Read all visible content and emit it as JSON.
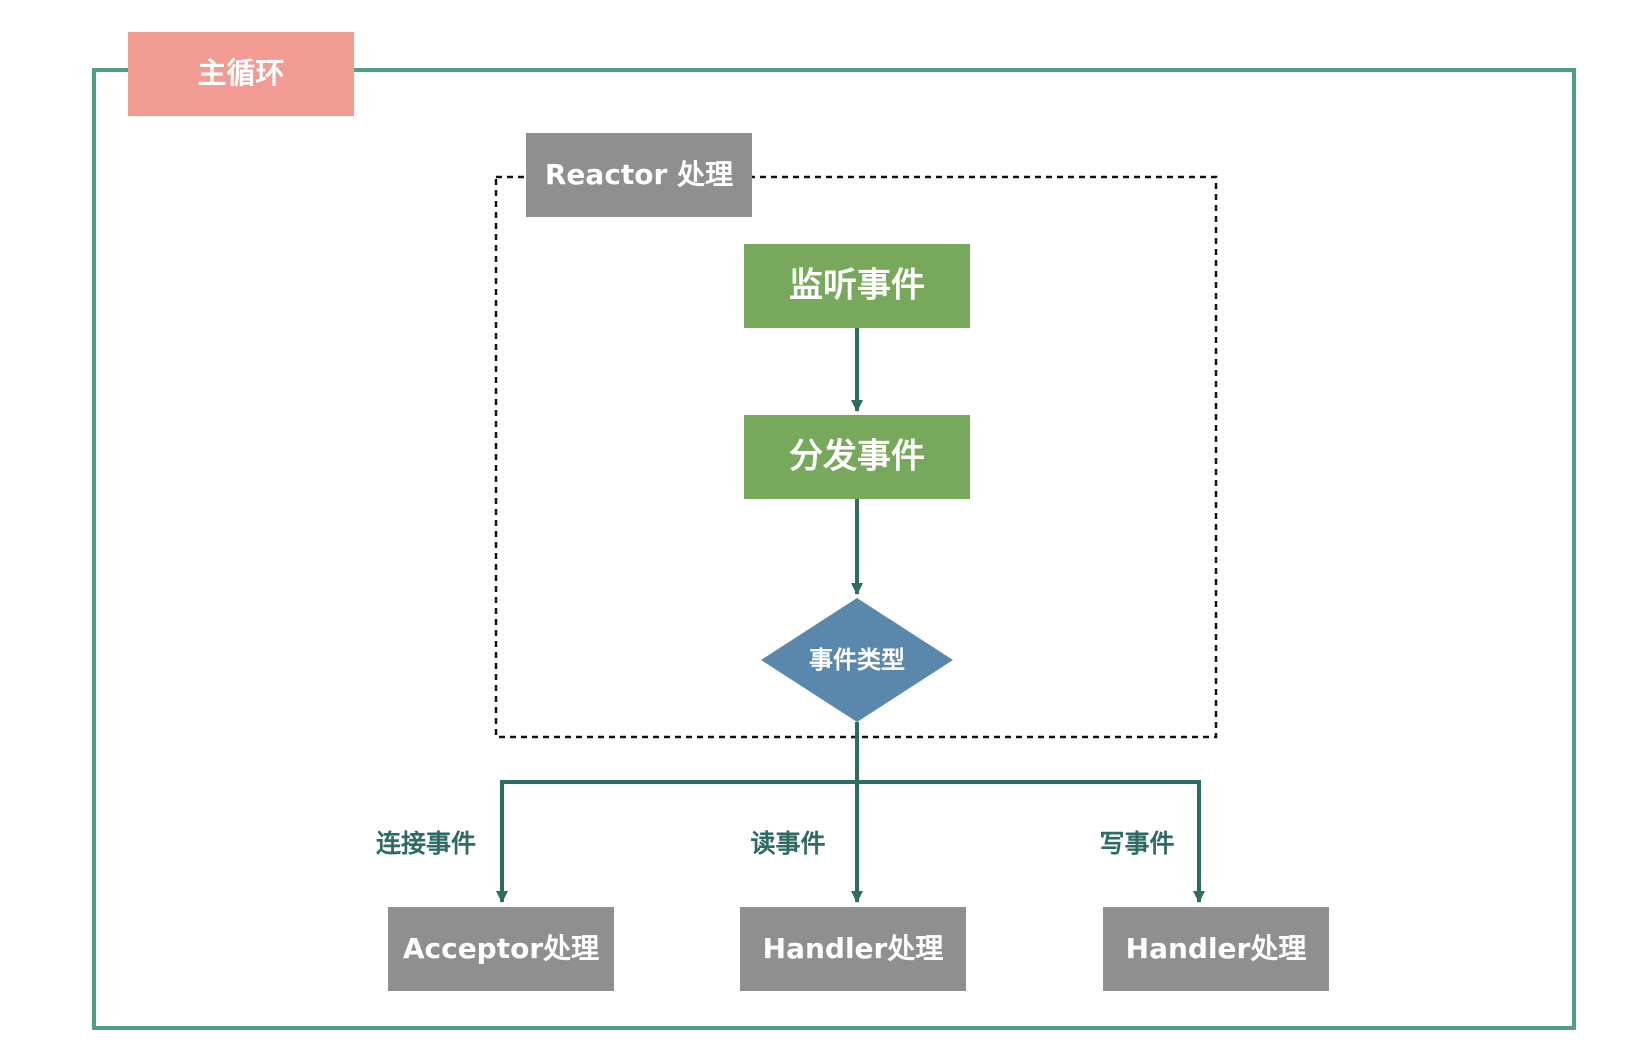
{
  "main_loop": {
    "title": "主循环",
    "border_color": "#4f9e8a",
    "title_bg": "#f29b92"
  },
  "reactor": {
    "title": "Reactor 处理",
    "title_bg": "#8f8f8f"
  },
  "nodes": {
    "listen": "监听事件",
    "dispatch": "分发事件",
    "decision": "事件类型",
    "node_green": "#77a85c",
    "decision_blue": "#5a88ad"
  },
  "branches": [
    {
      "edge_label": "连接事件",
      "handler": "Acceptor处理"
    },
    {
      "edge_label": "读事件",
      "handler": "Handler处理"
    },
    {
      "edge_label": "写事件",
      "handler": "Handler处理"
    }
  ],
  "colors": {
    "arrow": "#2e6b63",
    "handler_bg": "#8f8f8f",
    "text_light": "#ffffff"
  }
}
